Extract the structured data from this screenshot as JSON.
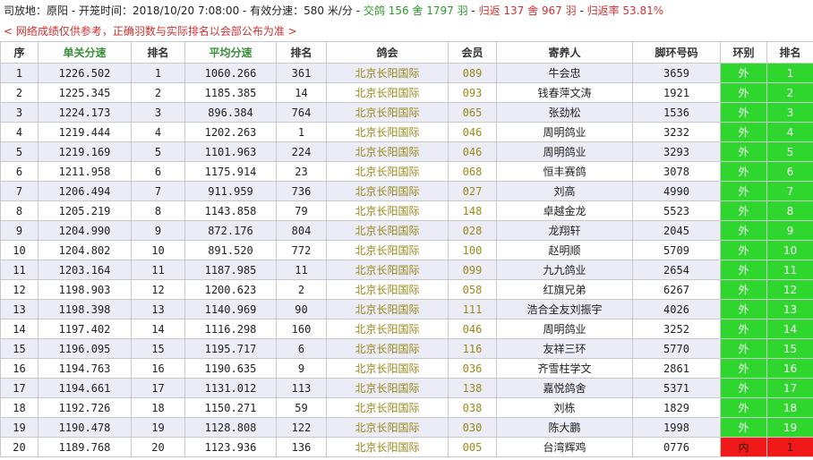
{
  "header": {
    "prefix": "司放地：原阳 - 开笼时间：2018/10/20 7:08:00 - 有效分速：580 米/分 - ",
    "entry": "交鸽 156 舍 1797 羽",
    "sep": " - ",
    "returned": "归返 137 舍 967 羽",
    "sep2": " - ",
    "rate": "归返率 53.81%"
  },
  "notice": "< 网络成绩仅供参考，正确羽数与实际排名以会部公布为准 >",
  "columns": [
    "序",
    "单关分速",
    "排名",
    "平均分速",
    "排名",
    "鸽会",
    "会员",
    "寄养人",
    "脚环号码",
    "环别",
    "排名"
  ],
  "colors": {
    "accent_green": "#2ed62e",
    "accent_red": "#f01818",
    "row_alt": "#ececf6"
  },
  "rows": [
    {
      "seq": "1",
      "single": "1226.502",
      "rank1": "1",
      "avg": "1060.266",
      "rank2": "361",
      "club": "北京长阳国际",
      "member": "089",
      "owner": "牛会忠",
      "ring": "3659",
      "zone": "外",
      "zrank": "1"
    },
    {
      "seq": "2",
      "single": "1225.345",
      "rank1": "2",
      "avg": "1185.385",
      "rank2": "14",
      "club": "北京长阳国际",
      "member": "093",
      "owner": "钱春萍文涛",
      "ring": "1921",
      "zone": "外",
      "zrank": "2"
    },
    {
      "seq": "3",
      "single": "1224.173",
      "rank1": "3",
      "avg": "896.384",
      "rank2": "764",
      "club": "北京长阳国际",
      "member": "065",
      "owner": "张劲松",
      "ring": "1536",
      "zone": "外",
      "zrank": "3"
    },
    {
      "seq": "4",
      "single": "1219.444",
      "rank1": "4",
      "avg": "1202.263",
      "rank2": "1",
      "club": "北京长阳国际",
      "member": "046",
      "owner": "周明鸽业",
      "ring": "3232",
      "zone": "外",
      "zrank": "4"
    },
    {
      "seq": "5",
      "single": "1219.169",
      "rank1": "5",
      "avg": "1101.963",
      "rank2": "224",
      "club": "北京长阳国际",
      "member": "046",
      "owner": "周明鸽业",
      "ring": "3293",
      "zone": "外",
      "zrank": "5"
    },
    {
      "seq": "6",
      "single": "1211.958",
      "rank1": "6",
      "avg": "1175.914",
      "rank2": "23",
      "club": "北京长阳国际",
      "member": "068",
      "owner": "恒丰赛鸽",
      "ring": "3078",
      "zone": "外",
      "zrank": "6"
    },
    {
      "seq": "7",
      "single": "1206.494",
      "rank1": "7",
      "avg": "911.959",
      "rank2": "736",
      "club": "北京长阳国际",
      "member": "027",
      "owner": "刘高",
      "ring": "4990",
      "zone": "外",
      "zrank": "7"
    },
    {
      "seq": "8",
      "single": "1205.219",
      "rank1": "8",
      "avg": "1143.858",
      "rank2": "79",
      "club": "北京长阳国际",
      "member": "148",
      "owner": "卓越金龙",
      "ring": "5523",
      "zone": "外",
      "zrank": "8"
    },
    {
      "seq": "9",
      "single": "1204.990",
      "rank1": "9",
      "avg": "872.176",
      "rank2": "804",
      "club": "北京长阳国际",
      "member": "028",
      "owner": "龙翔轩",
      "ring": "2045",
      "zone": "外",
      "zrank": "9"
    },
    {
      "seq": "10",
      "single": "1204.802",
      "rank1": "10",
      "avg": "891.520",
      "rank2": "772",
      "club": "北京长阳国际",
      "member": "100",
      "owner": "赵明顺",
      "ring": "5709",
      "zone": "外",
      "zrank": "10"
    },
    {
      "seq": "11",
      "single": "1203.164",
      "rank1": "11",
      "avg": "1187.985",
      "rank2": "11",
      "club": "北京长阳国际",
      "member": "099",
      "owner": "九九鸽业",
      "ring": "2654",
      "zone": "外",
      "zrank": "11"
    },
    {
      "seq": "12",
      "single": "1198.903",
      "rank1": "12",
      "avg": "1200.623",
      "rank2": "2",
      "club": "北京长阳国际",
      "member": "058",
      "owner": "红旗兄弟",
      "ring": "6267",
      "zone": "外",
      "zrank": "12"
    },
    {
      "seq": "13",
      "single": "1198.398",
      "rank1": "13",
      "avg": "1140.969",
      "rank2": "90",
      "club": "北京长阳国际",
      "member": "111",
      "owner": "浩合全友刘振宇",
      "ring": "4026",
      "zone": "外",
      "zrank": "13"
    },
    {
      "seq": "14",
      "single": "1197.402",
      "rank1": "14",
      "avg": "1116.298",
      "rank2": "160",
      "club": "北京长阳国际",
      "member": "046",
      "owner": "周明鸽业",
      "ring": "3252",
      "zone": "外",
      "zrank": "14"
    },
    {
      "seq": "15",
      "single": "1196.095",
      "rank1": "15",
      "avg": "1195.717",
      "rank2": "6",
      "club": "北京长阳国际",
      "member": "116",
      "owner": "友祥三环",
      "ring": "5770",
      "zone": "外",
      "zrank": "15"
    },
    {
      "seq": "16",
      "single": "1194.763",
      "rank1": "16",
      "avg": "1190.635",
      "rank2": "9",
      "club": "北京长阳国际",
      "member": "036",
      "owner": "齐雪柱学文",
      "ring": "2861",
      "zone": "外",
      "zrank": "16"
    },
    {
      "seq": "17",
      "single": "1194.661",
      "rank1": "17",
      "avg": "1131.012",
      "rank2": "113",
      "club": "北京长阳国际",
      "member": "138",
      "owner": "嘉悦鸽舍",
      "ring": "5371",
      "zone": "外",
      "zrank": "17"
    },
    {
      "seq": "18",
      "single": "1192.726",
      "rank1": "18",
      "avg": "1150.271",
      "rank2": "59",
      "club": "北京长阳国际",
      "member": "038",
      "owner": "刘栋",
      "ring": "1829",
      "zone": "外",
      "zrank": "18"
    },
    {
      "seq": "19",
      "single": "1190.478",
      "rank1": "19",
      "avg": "1128.808",
      "rank2": "122",
      "club": "北京长阳国际",
      "member": "030",
      "owner": "陈大鹏",
      "ring": "1998",
      "zone": "外",
      "zrank": "19"
    },
    {
      "seq": "20",
      "single": "1189.768",
      "rank1": "20",
      "avg": "1123.936",
      "rank2": "136",
      "club": "北京长阳国际",
      "member": "005",
      "owner": "台湾辉鸡",
      "ring": "0776",
      "zone": "内",
      "zrank": "1"
    }
  ]
}
